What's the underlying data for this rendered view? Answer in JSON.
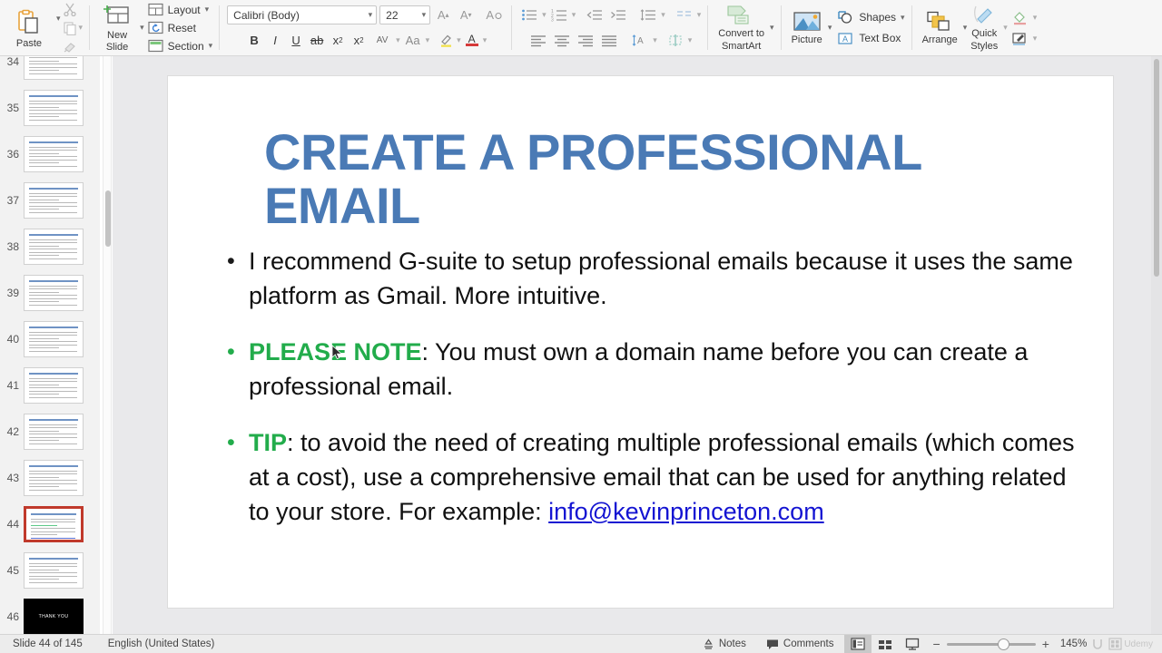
{
  "ribbon": {
    "paste": {
      "label": "Paste",
      "icon": "clipboard-icon"
    },
    "cut": {
      "icon": "scissors-icon"
    },
    "copy": {
      "icon": "copy-icon"
    },
    "format_painter": {
      "icon": "format-painter-icon"
    },
    "new_slide": {
      "label_line1": "New",
      "label_line2": "Slide",
      "icon": "new-slide-icon"
    },
    "layout": {
      "label": "Layout",
      "icon": "layout-icon"
    },
    "reset": {
      "label": "Reset",
      "icon": "reset-icon"
    },
    "section": {
      "label": "Section",
      "icon": "section-icon"
    },
    "font_name": "Calibri (Body)",
    "font_size": "22",
    "grow_font": "A",
    "shrink_font": "A",
    "clear_formatting": "A",
    "bold": "B",
    "italic": "I",
    "underline": "U",
    "strikethrough": "ab",
    "superscript": "x",
    "subscript": "x",
    "character_spacing": "AV",
    "change_case": "Aa",
    "highlight": "highlight-icon",
    "font_color": "font-color-icon",
    "convert_smartart": {
      "label_line1": "Convert to",
      "label_line2": "SmartArt"
    },
    "picture": {
      "label": "Picture",
      "icon": "picture-icon"
    },
    "shapes": {
      "label": "Shapes",
      "icon": "shapes-icon"
    },
    "text_box": {
      "label": "Text Box",
      "icon": "textbox-icon"
    },
    "arrange": {
      "label": "Arrange",
      "icon": "arrange-icon"
    },
    "quick_styles": {
      "label_line1": "Quick",
      "label_line2": "Styles",
      "icon": "quick-styles-icon"
    },
    "shape_fill": {
      "icon": "shape-fill-icon"
    },
    "shape_format": {
      "icon": "shape-format-icon"
    }
  },
  "thumbnails": {
    "items": [
      {
        "number": "34",
        "selected": false,
        "kind": "text"
      },
      {
        "number": "35",
        "selected": false,
        "kind": "text"
      },
      {
        "number": "36",
        "selected": false,
        "kind": "text"
      },
      {
        "number": "37",
        "selected": false,
        "kind": "text"
      },
      {
        "number": "38",
        "selected": false,
        "kind": "text"
      },
      {
        "number": "39",
        "selected": false,
        "kind": "text"
      },
      {
        "number": "40",
        "selected": false,
        "kind": "text"
      },
      {
        "number": "41",
        "selected": false,
        "kind": "text"
      },
      {
        "number": "42",
        "selected": false,
        "kind": "text"
      },
      {
        "number": "43",
        "selected": false,
        "kind": "text"
      },
      {
        "number": "44",
        "selected": true,
        "kind": "text"
      },
      {
        "number": "45",
        "selected": false,
        "kind": "text"
      },
      {
        "number": "46",
        "selected": false,
        "kind": "black",
        "label": "THANK YOU"
      }
    ]
  },
  "slide": {
    "title": "CREATE A PROFESSIONAL EMAIL",
    "bullets": [
      {
        "dot": "•",
        "dot_color": "black",
        "parts": [
          {
            "text": "I recommend G-suite to setup professional emails because it uses the same platform as Gmail. More intuitive.",
            "style": "normal"
          }
        ]
      },
      {
        "dot": "•",
        "dot_color": "green",
        "parts": [
          {
            "text": "PLEASE NOTE",
            "style": "keyword"
          },
          {
            "text": ": You must own a domain name before you can create a professional email.",
            "style": "normal"
          }
        ]
      },
      {
        "dot": "•",
        "dot_color": "green",
        "parts": [
          {
            "text": "TIP",
            "style": "keyword"
          },
          {
            "text": ": to avoid the need of creating multiple professional emails (which comes at a cost), use a comprehensive email that can be used for anything related to your store. For example: ",
            "style": "normal"
          },
          {
            "text": "info@kevinprinceton.com",
            "style": "link"
          }
        ]
      }
    ]
  },
  "status": {
    "slide_count": "Slide 44 of 145",
    "language": "English (United States)",
    "notes": "Notes",
    "comments": "Comments",
    "view_normal": "normal-view-icon",
    "view_sorter": "slide-sorter-icon",
    "view_show": "slideshow-icon",
    "zoom_out": "−",
    "zoom_in": "+",
    "zoom_level": "145%",
    "watermark": "Udemy"
  },
  "colors": {
    "title_blue": "#4a7ab5",
    "keyword_green": "#22ac4b",
    "link_blue": "#1414d2",
    "selection_red": "#c0392b"
  }
}
